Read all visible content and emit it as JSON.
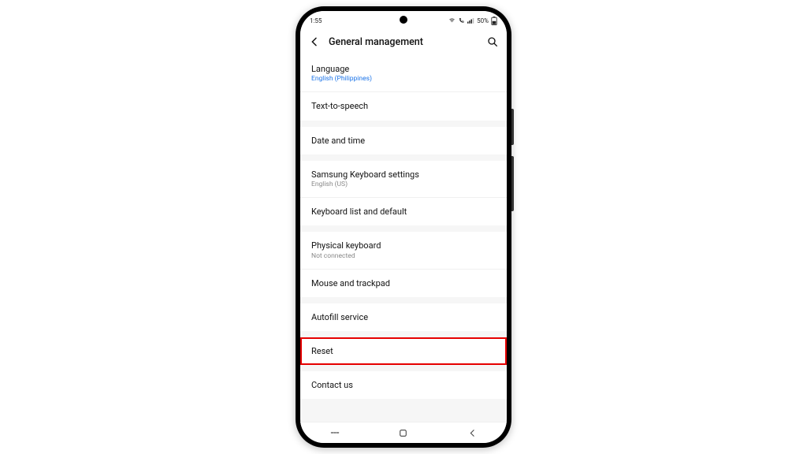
{
  "status": {
    "time": "1:55",
    "battery": "50%"
  },
  "header": {
    "title": "General management"
  },
  "groups": [
    {
      "rows": [
        {
          "label": "Language",
          "sub": "English (Philippines)",
          "subLink": true,
          "name": "row-language"
        },
        {
          "label": "Text-to-speech",
          "name": "row-text-to-speech"
        }
      ]
    },
    {
      "rows": [
        {
          "label": "Date and time",
          "name": "row-date-and-time"
        }
      ]
    },
    {
      "rows": [
        {
          "label": "Samsung Keyboard settings",
          "sub": "English (US)",
          "name": "row-samsung-keyboard"
        },
        {
          "label": "Keyboard list and default",
          "name": "row-keyboard-list"
        }
      ]
    },
    {
      "rows": [
        {
          "label": "Physical keyboard",
          "sub": "Not connected",
          "name": "row-physical-keyboard"
        },
        {
          "label": "Mouse and trackpad",
          "name": "row-mouse-trackpad"
        }
      ]
    },
    {
      "rows": [
        {
          "label": "Autofill service",
          "name": "row-autofill"
        }
      ]
    },
    {
      "rows": [
        {
          "label": "Reset",
          "highlight": true,
          "name": "row-reset"
        }
      ]
    },
    {
      "rows": [
        {
          "label": "Contact us",
          "name": "row-contact-us"
        }
      ]
    }
  ]
}
